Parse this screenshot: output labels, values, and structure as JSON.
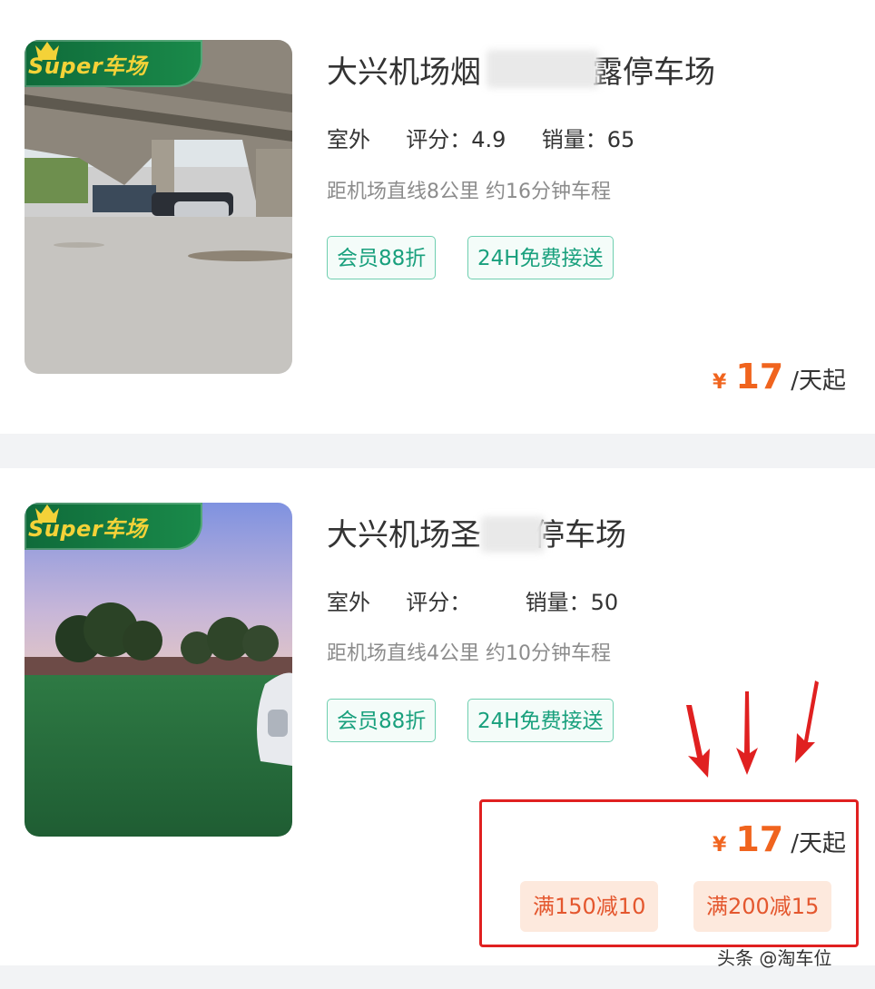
{
  "listings": [
    {
      "badge": "Super车场",
      "title_visible": "大兴机场",
      "title_start": "烟",
      "title_end": "露停车场",
      "type": "室外",
      "rating_label": "评分：",
      "rating": "4.9",
      "sales_label": "销量：",
      "sales": "65",
      "distance": "距机场直线8公里 约16分钟车程",
      "tags": [
        "会员88折",
        "24H免费接送"
      ],
      "currency": "¥",
      "price": "17",
      "price_unit": "/天起"
    },
    {
      "badge": "Super车场",
      "title_visible": "大兴机场",
      "title_start": "圣",
      "title_end": "停车场",
      "type": "室外",
      "rating_label": "评分：",
      "rating": "",
      "sales_label": "销量：",
      "sales": "50",
      "distance": "距机场直线4公里 约10分钟车程",
      "tags": [
        "会员88折",
        "24H免费接送"
      ],
      "currency": "¥",
      "price": "17",
      "price_unit": "/天起",
      "coupons": [
        "满150减10",
        "满200减15"
      ]
    }
  ],
  "watermark": "头条 @淘车位",
  "colors": {
    "accent_orange": "#f0641e",
    "tag_green": "#19a07d",
    "highlight_red": "#e02020",
    "badge_green": "#0f6b3a",
    "badge_gold": "#f4d238"
  },
  "icons": [
    "crown-icon",
    "arrow-down-icon"
  ]
}
